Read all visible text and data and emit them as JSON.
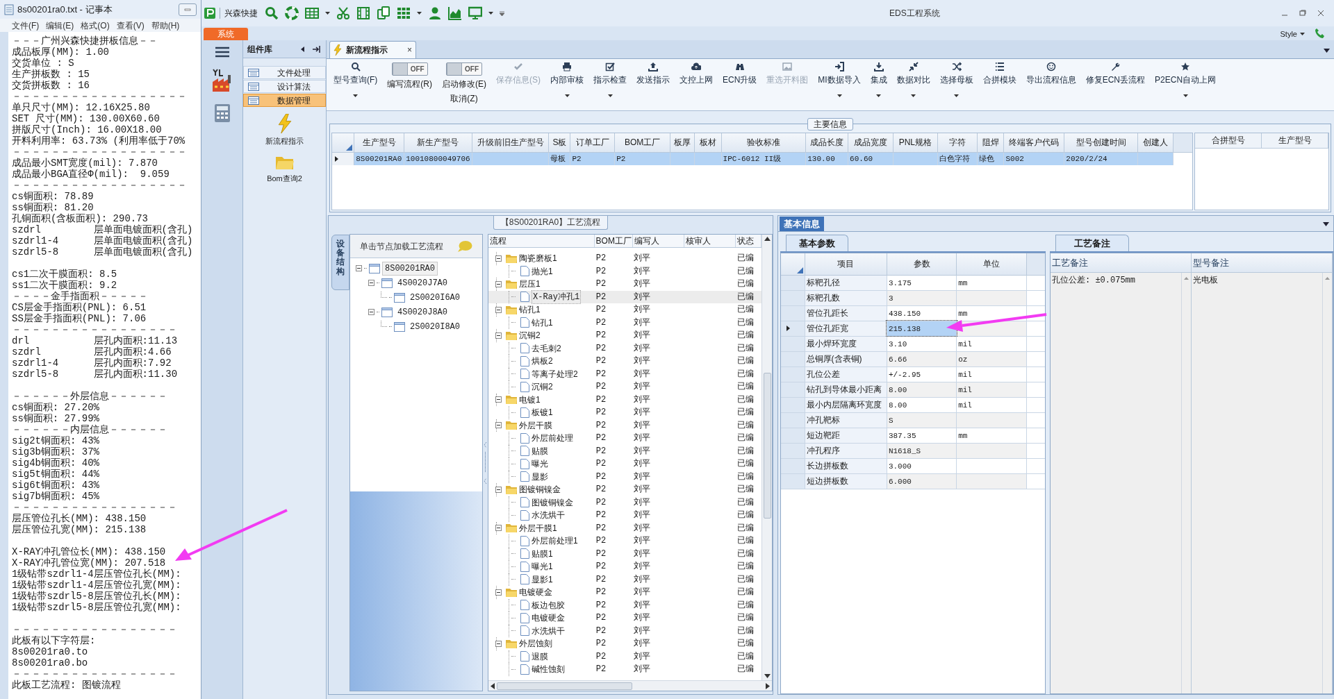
{
  "notepad": {
    "title": "8s00201ra0.txt - 记事本",
    "menu": [
      "文件(F)",
      "编辑(E)",
      "格式(O)",
      "查看(V)",
      "帮助(H)"
    ],
    "paragraphs": [
      [
        "－－－广州兴森快捷拼板信息－－",
        "成品板厚(MM): 1.00",
        "交货单位 : S",
        "生产拼板数 : 15",
        "交货拼板数 : 16",
        "－－－－－－－－－－－－－－－－－－",
        "单只尺寸(MM): 12.16X25.80",
        "SET 尺寸(MM): 130.00X60.60",
        "拼版尺寸(Inch): 16.00X18.00",
        "开料利用率: 63.73% (利用率低于70%",
        "－－－－－－－－－－－－－－－－－－",
        "成品最小SMT宽度(mil): 7.870",
        "成品最小BGA直径Φ(mil):  9.059",
        "－－－－－－－－－－－－－－－－－－",
        "cs铜面积: 78.89",
        "ss铜面积: 81.20",
        "孔铜面积(含板面积): 290.73",
        "szdrl         层单面电镀面积(含孔)",
        "szdrl1-4      层单面电镀面积(含孔)",
        "szdrl5-8      层单面电镀面积(含孔)"
      ],
      [
        "cs1二次干膜面积: 8.5",
        "ss1二次干膜面积: 9.2",
        "－－－－金手指面积－－－－－",
        "CS层金手指面积(PNL): 6.51",
        "SS层金手指面积(PNL): 7.06",
        "－－－－－－－－－－－－－－－－－",
        "drl           层孔内面积:11.13",
        "szdrl         层孔内面积:4.66",
        "szdrl1-4      层孔内面积:7.92",
        "szdrl5-8      层孔内面积:11.30"
      ],
      [
        "－－－－－－外层信息－－－－－－",
        "cs铜面积: 27.20%",
        "ss铜面积: 27.99%",
        "－－－－－－内层信息－－－－－－",
        "sig2t铜面积: 43%",
        "sig3b铜面积: 37%",
        "sig4b铜面积: 40%",
        "sig5t铜面积: 44%",
        "sig6t铜面积: 43%",
        "sig7b铜面积: 45%",
        "－－－－－－－－－－－－－－－－－",
        "层压管位孔长(MM): 438.150",
        "层压管位孔宽(MM): 215.138"
      ],
      [
        "X-RAY冲孔管位长(MM): 438.150",
        "X-RAY冲孔管位宽(MM): 207.518",
        "1级钻带szdrl1-4层压管位孔长(MM):",
        "1级钻带szdrl1-4层压管位孔宽(MM):",
        "1级钻带szdrl5-8层压管位孔长(MM):",
        "1级钻带szdrl5-8层压管位孔宽(MM):"
      ],
      [
        "－－－－－－－－－－－－－－－－－",
        "此板有以下字符层:",
        "8s00201ra0.to",
        "8s00201ra0.bo",
        "－－－－－－－－－－－－－－－－－",
        "此板工艺流程: 图镀流程"
      ]
    ]
  },
  "app": {
    "brand": "兴森快捷",
    "title": "EDS工程系统",
    "menu_tab": "系统",
    "style_label": "Style"
  },
  "components": {
    "header": "组件库",
    "items": [
      {
        "label": "文件处理",
        "selected": false
      },
      {
        "label": "设计算法",
        "selected": false
      },
      {
        "label": "数据管理",
        "selected": true
      }
    ],
    "tools": [
      "新流程指示",
      "Bom查询2"
    ]
  },
  "doc_tab": {
    "label": "新流程指示",
    "close": "×"
  },
  "ribbon": [
    {
      "kind": "button",
      "label": "型号查询(F)",
      "disabled": false,
      "dropdown": true
    },
    {
      "kind": "toggle",
      "label": "编写流程(R)",
      "state_text": "OFF",
      "on": false
    },
    {
      "kind": "toggle",
      "label": "启动修改(E)",
      "state_text": "OFF",
      "on": false,
      "label2": "取消(Z)"
    },
    {
      "kind": "button",
      "label": "保存信息(S)",
      "disabled": true,
      "dropdown": false
    },
    {
      "kind": "button",
      "label": "内部审核",
      "disabled": false,
      "dropdown": true
    },
    {
      "kind": "button",
      "label": "指示检查",
      "disabled": false,
      "dropdown": true
    },
    {
      "kind": "button",
      "label": "发送指示",
      "disabled": false,
      "dropdown": false
    },
    {
      "kind": "button",
      "label": "文控上网",
      "disabled": false,
      "dropdown": false
    },
    {
      "kind": "button",
      "label": "ECN升级",
      "disabled": false,
      "dropdown": false
    },
    {
      "kind": "button",
      "label": "重选开料图",
      "disabled": true,
      "dropdown": false
    },
    {
      "kind": "button",
      "label": "MI数据导入",
      "disabled": false,
      "dropdown": true
    },
    {
      "kind": "button",
      "label": "集成",
      "disabled": false,
      "dropdown": true
    },
    {
      "kind": "button",
      "label": "数据对比",
      "disabled": false,
      "dropdown": true
    },
    {
      "kind": "button",
      "label": "选择母板",
      "disabled": false,
      "dropdown": true
    },
    {
      "kind": "button",
      "label": "合拼模块",
      "disabled": false,
      "dropdown": false
    },
    {
      "kind": "button",
      "label": "导出流程信息",
      "disabled": false,
      "dropdown": false
    },
    {
      "kind": "button",
      "label": "修复ECN丢流程",
      "disabled": false,
      "dropdown": false
    },
    {
      "kind": "button",
      "label": "P2ECN自动上网",
      "disabled": false,
      "dropdown": true
    }
  ],
  "main_info": {
    "title": "主要信息",
    "columns": [
      "生产型号",
      "新生产型号",
      "升级前旧生产型号",
      "S板",
      "订单工厂",
      "BOM工厂",
      "板厚",
      "板材",
      "验收标准",
      "成品长度",
      "成品宽度",
      "PNL规格",
      "字符",
      "阻焊",
      "终端客户代码",
      "型号创建时间",
      "创建人"
    ],
    "rows": [
      {
        "selected": true,
        "cells": [
          "8S00201RA0",
          "10010800049706",
          null,
          "母板",
          "P2",
          "P2",
          null,
          null,
          "IPC-6012 II级",
          "130.00",
          "60.60",
          null,
          "白色字符",
          "绿色",
          "S002",
          "2020/2/24",
          null
        ]
      }
    ],
    "side_columns": [
      "合拼型号",
      "生产型号"
    ]
  },
  "flow": {
    "title": "【8S00201RA0】工艺流程",
    "side_tab": "设备结构",
    "hint": "单击节点加载工艺流程",
    "structure": [
      {
        "label": "8S00201RA0",
        "selected": true,
        "expanded": true,
        "children": [
          {
            "label": "4S0020J7A0",
            "selected": false,
            "expanded": true,
            "children": [
              {
                "label": "2S0020I6A0",
                "selected": false
              }
            ]
          },
          {
            "label": "4S0020J8A0",
            "selected": false,
            "expanded": true,
            "children": [
              {
                "label": "2S0020I8A0",
                "selected": false
              }
            ]
          }
        ]
      }
    ],
    "columns": [
      "流程",
      "BOM工厂",
      "编写人",
      "核审人",
      "状态"
    ],
    "steps": [
      {
        "label": "陶瓷磨板1",
        "bom": "P2",
        "writer": "刘平",
        "status": "已编",
        "selected": false,
        "expanded": true,
        "children": [
          {
            "label": "抛光1",
            "bom": "P2",
            "writer": "刘平",
            "status": "已编",
            "selected": false
          }
        ]
      },
      {
        "label": "层压1",
        "bom": "P2",
        "writer": "刘平",
        "status": "已编",
        "selected": false,
        "expanded": true,
        "children": [
          {
            "label": "X-Ray冲孔1",
            "bom": "P2",
            "writer": "刘平",
            "status": "已编",
            "selected": true
          }
        ]
      },
      {
        "label": "钻孔1",
        "bom": "P2",
        "writer": "刘平",
        "status": "已编",
        "selected": false,
        "expanded": true,
        "children": [
          {
            "label": "钻孔1",
            "bom": "P2",
            "writer": "刘平",
            "status": "已编",
            "selected": false
          }
        ]
      },
      {
        "label": "沉铜2",
        "bom": "P2",
        "writer": "刘平",
        "status": "已编",
        "selected": false,
        "expanded": true,
        "children": [
          {
            "label": "去毛刺2",
            "bom": "P2",
            "writer": "刘平",
            "status": "已编",
            "selected": false
          },
          {
            "label": "烘板2",
            "bom": "P2",
            "writer": "刘平",
            "status": "已编",
            "selected": false
          },
          {
            "label": "等离子处理2",
            "bom": "P2",
            "writer": "刘平",
            "status": "已编",
            "selected": false
          },
          {
            "label": "沉铜2",
            "bom": "P2",
            "writer": "刘平",
            "status": "已编",
            "selected": false
          }
        ]
      },
      {
        "label": "电镀1",
        "bom": "P2",
        "writer": "刘平",
        "status": "已编",
        "selected": false,
        "expanded": true,
        "children": [
          {
            "label": "板镀1",
            "bom": "P2",
            "writer": "刘平",
            "status": "已编",
            "selected": false
          }
        ]
      },
      {
        "label": "外层干膜",
        "bom": "P2",
        "writer": "刘平",
        "status": "已编",
        "selected": false,
        "expanded": true,
        "children": [
          {
            "label": "外层前处理",
            "bom": "P2",
            "writer": "刘平",
            "status": "已编",
            "selected": false
          },
          {
            "label": "贴膜",
            "bom": "P2",
            "writer": "刘平",
            "status": "已编",
            "selected": false
          },
          {
            "label": "曝光",
            "bom": "P2",
            "writer": "刘平",
            "status": "已编",
            "selected": false
          },
          {
            "label": "显影",
            "bom": "P2",
            "writer": "刘平",
            "status": "已编",
            "selected": false
          }
        ]
      },
      {
        "label": "图镀铜镍金",
        "bom": "P2",
        "writer": "刘平",
        "status": "已编",
        "selected": false,
        "expanded": true,
        "children": [
          {
            "label": "图镀铜镍金",
            "bom": "P2",
            "writer": "刘平",
            "status": "已编",
            "selected": false
          },
          {
            "label": "水洗烘干",
            "bom": "P2",
            "writer": "刘平",
            "status": "已编",
            "selected": false
          }
        ]
      },
      {
        "label": "外层干膜1",
        "bom": "P2",
        "writer": "刘平",
        "status": "已编",
        "selected": false,
        "expanded": true,
        "children": [
          {
            "label": "外层前处理1",
            "bom": "P2",
            "writer": "刘平",
            "status": "已编",
            "selected": false
          },
          {
            "label": "贴膜1",
            "bom": "P2",
            "writer": "刘平",
            "status": "已编",
            "selected": false
          },
          {
            "label": "曝光1",
            "bom": "P2",
            "writer": "刘平",
            "status": "已编",
            "selected": false
          },
          {
            "label": "显影1",
            "bom": "P2",
            "writer": "刘平",
            "status": "已编",
            "selected": false
          }
        ]
      },
      {
        "label": "电镀硬金",
        "bom": "P2",
        "writer": "刘平",
        "status": "已编",
        "selected": false,
        "expanded": true,
        "children": [
          {
            "label": "板边包胶",
            "bom": "P2",
            "writer": "刘平",
            "status": "已编",
            "selected": false
          },
          {
            "label": "电镀硬金",
            "bom": "P2",
            "writer": "刘平",
            "status": "已编",
            "selected": false
          },
          {
            "label": "水洗烘干",
            "bom": "P2",
            "writer": "刘平",
            "status": "已编",
            "selected": false
          }
        ]
      },
      {
        "label": "外层蚀刻",
        "bom": "P2",
        "writer": "刘平",
        "status": "已编",
        "selected": false,
        "expanded": true,
        "children": [
          {
            "label": "退膜",
            "bom": "P2",
            "writer": "刘平",
            "status": "已编",
            "selected": false
          },
          {
            "label": "碱性蚀刻",
            "bom": "P2",
            "writer": "刘平",
            "status": "已编",
            "selected": false
          }
        ]
      }
    ]
  },
  "basic": {
    "title": "基本信息",
    "params_tab": "基本参数",
    "columns": [
      "项目",
      "参数",
      "单位"
    ],
    "rows": [
      {
        "item": "标靶孔径",
        "value": "3.175",
        "unit": "mm",
        "selected": false
      },
      {
        "item": "标靶孔数",
        "value": "3",
        "selected": false
      },
      {
        "item": "管位孔距长",
        "value": "438.150",
        "unit": "mm",
        "selected": false
      },
      {
        "item": "管位孔距宽",
        "value": "215.138",
        "selected": true
      },
      {
        "item": "最小焊环宽度",
        "value": "3.10",
        "unit": "mil",
        "selected": false
      },
      {
        "item": "总铜厚(含表铜)",
        "value": "6.66",
        "unit": "oz",
        "selected": false
      },
      {
        "item": "孔位公差",
        "value": "+/-2.95",
        "unit": "mil",
        "selected": false
      },
      {
        "item": "钻孔到导体最小距离",
        "value": "8.00",
        "unit": "mil",
        "selected": false
      },
      {
        "item": "最小内层隔离环宽度",
        "value": "8.00",
        "unit": "mil",
        "selected": false
      },
      {
        "item": "冲孔靶标",
        "value": "S",
        "selected": false
      },
      {
        "item": "短边靶距",
        "value": "387.35",
        "unit": "mm",
        "selected": false
      },
      {
        "item": "冲孔程序",
        "value": "N1618_S",
        "selected": false
      },
      {
        "item": "长边拼板数",
        "value": "3.000",
        "selected": false
      },
      {
        "item": "短边拼板数",
        "value": "6.000",
        "selected": false
      }
    ],
    "notes_tab": "工艺备注",
    "note_columns": [
      "工艺备注",
      "型号备注"
    ],
    "notes": [
      "孔位公差: ±0.075mm",
      "光电板"
    ]
  }
}
